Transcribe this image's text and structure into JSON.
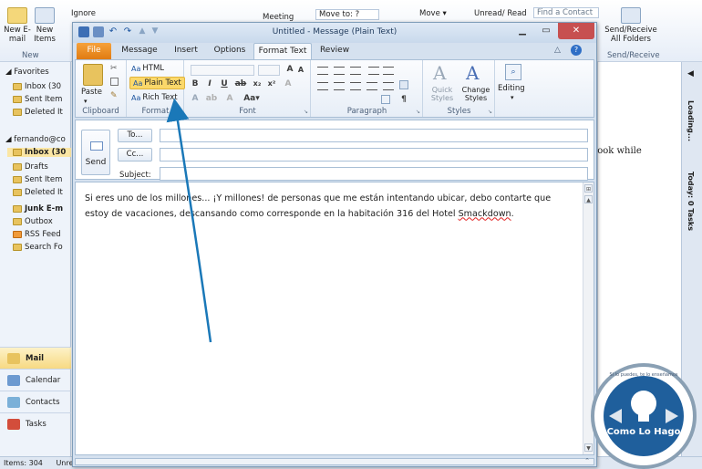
{
  "background_window": {
    "ribbon": {
      "new_email": "New E-mail",
      "new_items": "New Items",
      "group_new": "New",
      "ignore": "Ignore",
      "meeting": "Meeting",
      "move_to": "Move to: ?",
      "move": "Move",
      "unread_read": "Unread/ Read",
      "find_contact": "Find a Contact",
      "send_receive_all": "Send/Receive All Folders",
      "group_send_receive": "Send/Receive"
    },
    "nav": {
      "favorites": "Favorites",
      "favorites_items": [
        "Inbox (30",
        "Sent Item",
        "Deleted It"
      ],
      "account": "fernando@co",
      "account_items": [
        {
          "label": "Inbox (30",
          "selected": true
        },
        {
          "label": "Drafts",
          "selected": false
        },
        {
          "label": "Sent Item",
          "selected": false
        },
        {
          "label": "Deleted It",
          "selected": false
        },
        {
          "label": "Junk E-m",
          "selected": false
        },
        {
          "label": "Outbox",
          "selected": false
        },
        {
          "label": "RSS Feed",
          "selected": false
        },
        {
          "label": "Search Fo",
          "selected": false
        }
      ],
      "buttons": [
        "Mail",
        "Calendar",
        "Contacts",
        "Tasks"
      ]
    },
    "reading_pane_text": "look while",
    "todo_bar": {
      "loading": "Loading...",
      "tasks": "Today: 0 Tasks"
    },
    "status_bar": {
      "items": "Items: 304",
      "unread": "Unre"
    }
  },
  "message_window": {
    "title": "Untitled - Message (Plain Text)",
    "tabs": [
      "File",
      "Message",
      "Insert",
      "Options",
      "Format Text",
      "Review"
    ],
    "active_tab": "Format Text",
    "ribbon": {
      "paste": "Paste",
      "clipboard": "Clipboard",
      "html": "HTML",
      "plain_text": "Plain Text",
      "rich_text": "Rich Text",
      "format": "Format",
      "font": "Font",
      "paragraph": "Paragraph",
      "quick_styles": "Quick Styles",
      "change_styles": "Change Styles",
      "styles": "Styles",
      "editing": "Editing"
    },
    "header": {
      "send": "Send",
      "to": "To...",
      "cc": "Cc...",
      "subject": "Subject:"
    },
    "body": {
      "text_before": "Si eres uno de los millones... ¡Y millones! de personas que me están intentando ubicar, debo contarte que estoy de vacaciones, descansando como corresponde en la habitación 316 del Hotel ",
      "misspelled": "Smackdown",
      "text_after": "."
    }
  },
  "logo": {
    "tagline": "Si lo puedes, te lo enseñamos",
    "brand": "Como Lo Hago"
  },
  "colors": {
    "file_tab": "#e07b12",
    "annotation_arrow": "#1a78b8",
    "plain_text_highlight": "#fbd86a",
    "logo_ring": "#8aa0b4",
    "logo_center": "#1f5f9c"
  }
}
